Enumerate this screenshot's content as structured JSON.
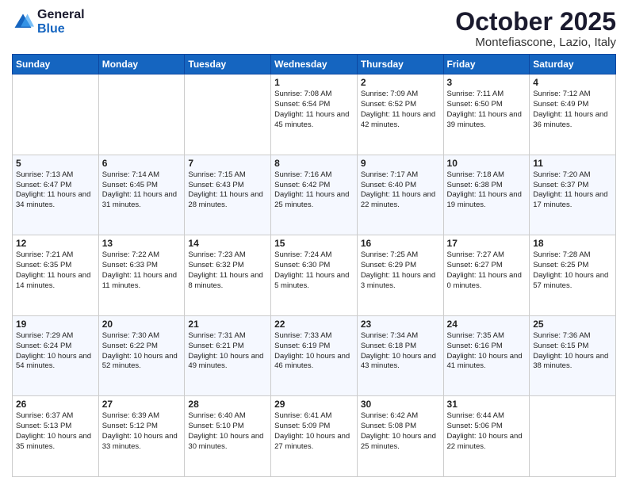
{
  "logo": {
    "line1": "General",
    "line2": "Blue"
  },
  "title": "October 2025",
  "location": "Montefiascone, Lazio, Italy",
  "days_of_week": [
    "Sunday",
    "Monday",
    "Tuesday",
    "Wednesday",
    "Thursday",
    "Friday",
    "Saturday"
  ],
  "weeks": [
    [
      {
        "day": "",
        "text": ""
      },
      {
        "day": "",
        "text": ""
      },
      {
        "day": "",
        "text": ""
      },
      {
        "day": "1",
        "text": "Sunrise: 7:08 AM\nSunset: 6:54 PM\nDaylight: 11 hours and 45 minutes."
      },
      {
        "day": "2",
        "text": "Sunrise: 7:09 AM\nSunset: 6:52 PM\nDaylight: 11 hours and 42 minutes."
      },
      {
        "day": "3",
        "text": "Sunrise: 7:11 AM\nSunset: 6:50 PM\nDaylight: 11 hours and 39 minutes."
      },
      {
        "day": "4",
        "text": "Sunrise: 7:12 AM\nSunset: 6:49 PM\nDaylight: 11 hours and 36 minutes."
      }
    ],
    [
      {
        "day": "5",
        "text": "Sunrise: 7:13 AM\nSunset: 6:47 PM\nDaylight: 11 hours and 34 minutes."
      },
      {
        "day": "6",
        "text": "Sunrise: 7:14 AM\nSunset: 6:45 PM\nDaylight: 11 hours and 31 minutes."
      },
      {
        "day": "7",
        "text": "Sunrise: 7:15 AM\nSunset: 6:43 PM\nDaylight: 11 hours and 28 minutes."
      },
      {
        "day": "8",
        "text": "Sunrise: 7:16 AM\nSunset: 6:42 PM\nDaylight: 11 hours and 25 minutes."
      },
      {
        "day": "9",
        "text": "Sunrise: 7:17 AM\nSunset: 6:40 PM\nDaylight: 11 hours and 22 minutes."
      },
      {
        "day": "10",
        "text": "Sunrise: 7:18 AM\nSunset: 6:38 PM\nDaylight: 11 hours and 19 minutes."
      },
      {
        "day": "11",
        "text": "Sunrise: 7:20 AM\nSunset: 6:37 PM\nDaylight: 11 hours and 17 minutes."
      }
    ],
    [
      {
        "day": "12",
        "text": "Sunrise: 7:21 AM\nSunset: 6:35 PM\nDaylight: 11 hours and 14 minutes."
      },
      {
        "day": "13",
        "text": "Sunrise: 7:22 AM\nSunset: 6:33 PM\nDaylight: 11 hours and 11 minutes."
      },
      {
        "day": "14",
        "text": "Sunrise: 7:23 AM\nSunset: 6:32 PM\nDaylight: 11 hours and 8 minutes."
      },
      {
        "day": "15",
        "text": "Sunrise: 7:24 AM\nSunset: 6:30 PM\nDaylight: 11 hours and 5 minutes."
      },
      {
        "day": "16",
        "text": "Sunrise: 7:25 AM\nSunset: 6:29 PM\nDaylight: 11 hours and 3 minutes."
      },
      {
        "day": "17",
        "text": "Sunrise: 7:27 AM\nSunset: 6:27 PM\nDaylight: 11 hours and 0 minutes."
      },
      {
        "day": "18",
        "text": "Sunrise: 7:28 AM\nSunset: 6:25 PM\nDaylight: 10 hours and 57 minutes."
      }
    ],
    [
      {
        "day": "19",
        "text": "Sunrise: 7:29 AM\nSunset: 6:24 PM\nDaylight: 10 hours and 54 minutes."
      },
      {
        "day": "20",
        "text": "Sunrise: 7:30 AM\nSunset: 6:22 PM\nDaylight: 10 hours and 52 minutes."
      },
      {
        "day": "21",
        "text": "Sunrise: 7:31 AM\nSunset: 6:21 PM\nDaylight: 10 hours and 49 minutes."
      },
      {
        "day": "22",
        "text": "Sunrise: 7:33 AM\nSunset: 6:19 PM\nDaylight: 10 hours and 46 minutes."
      },
      {
        "day": "23",
        "text": "Sunrise: 7:34 AM\nSunset: 6:18 PM\nDaylight: 10 hours and 43 minutes."
      },
      {
        "day": "24",
        "text": "Sunrise: 7:35 AM\nSunset: 6:16 PM\nDaylight: 10 hours and 41 minutes."
      },
      {
        "day": "25",
        "text": "Sunrise: 7:36 AM\nSunset: 6:15 PM\nDaylight: 10 hours and 38 minutes."
      }
    ],
    [
      {
        "day": "26",
        "text": "Sunrise: 6:37 AM\nSunset: 5:13 PM\nDaylight: 10 hours and 35 minutes."
      },
      {
        "day": "27",
        "text": "Sunrise: 6:39 AM\nSunset: 5:12 PM\nDaylight: 10 hours and 33 minutes."
      },
      {
        "day": "28",
        "text": "Sunrise: 6:40 AM\nSunset: 5:10 PM\nDaylight: 10 hours and 30 minutes."
      },
      {
        "day": "29",
        "text": "Sunrise: 6:41 AM\nSunset: 5:09 PM\nDaylight: 10 hours and 27 minutes."
      },
      {
        "day": "30",
        "text": "Sunrise: 6:42 AM\nSunset: 5:08 PM\nDaylight: 10 hours and 25 minutes."
      },
      {
        "day": "31",
        "text": "Sunrise: 6:44 AM\nSunset: 5:06 PM\nDaylight: 10 hours and 22 minutes."
      },
      {
        "day": "",
        "text": ""
      }
    ]
  ]
}
